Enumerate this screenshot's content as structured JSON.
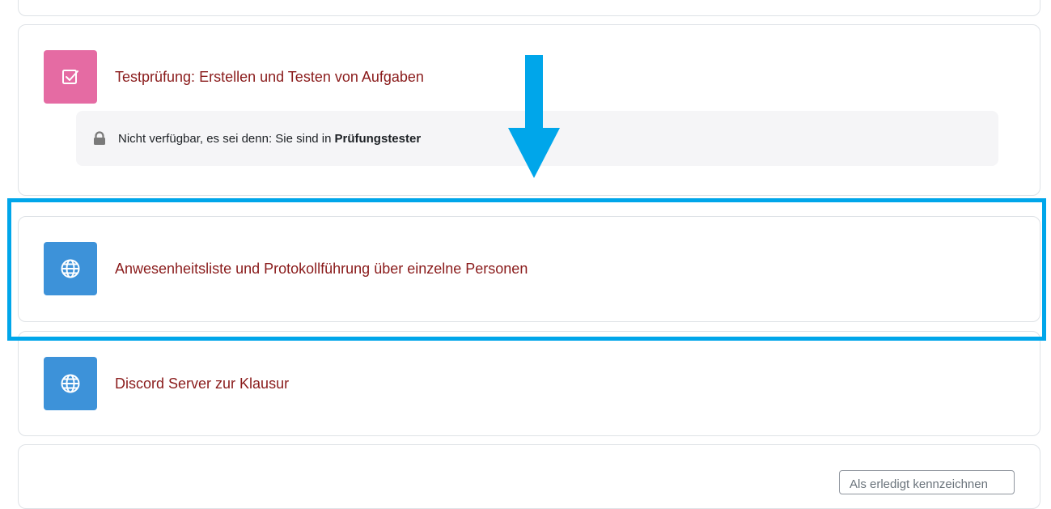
{
  "activities": [
    {
      "title": "Testprüfung: Erstellen und Testen von Aufgaben",
      "icon": "quiz-checkbox-icon",
      "icon_color": "#e56ba3",
      "restriction": {
        "text": "Nicht verfügbar, es sei denn: Sie sind in",
        "group": "Prüfungstester",
        "icon": "lock-icon"
      }
    },
    {
      "title": "Anwesenheitsliste und Protokollführung über einzelne Personen",
      "icon": "globe-icon",
      "icon_color": "#3d92d9"
    },
    {
      "title": "Discord Server zur Klausur",
      "icon": "globe-icon",
      "icon_color": "#3d92d9"
    }
  ],
  "annotations": {
    "highlight_color": "#00a6ea",
    "arrow_color": "#00a6ea"
  },
  "partial_field": {
    "text": "Als erledigt kennzeichnen"
  }
}
